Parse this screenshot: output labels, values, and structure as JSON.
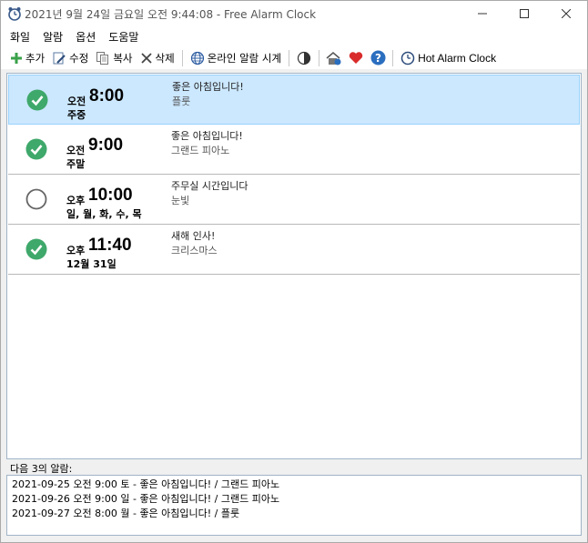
{
  "window": {
    "title": "2021년 9월 24일 금요일 오전 9:44:08 - Free Alarm Clock"
  },
  "menu": [
    "화일",
    "알람",
    "옵션",
    "도움말"
  ],
  "toolbar": {
    "add": "추가",
    "edit": "수정",
    "copy": "복사",
    "delete": "삭제",
    "online": "온라인 알람 시계",
    "hot": "Hot Alarm Clock"
  },
  "alarms": [
    {
      "enabled": true,
      "ampm": "오전",
      "time": "8:00",
      "days": "주중",
      "message": "좋은 아침입니다!",
      "sound": "플룻"
    },
    {
      "enabled": true,
      "ampm": "오전",
      "time": "9:00",
      "days": "주말",
      "message": "좋은 아침입니다!",
      "sound": "그랜드 피아노"
    },
    {
      "enabled": false,
      "ampm": "오후",
      "time": "10:00",
      "days": "일, 월, 화, 수, 목",
      "message": "주무실 시간입니다",
      "sound": "눈빛"
    },
    {
      "enabled": true,
      "ampm": "오후",
      "time": "11:40",
      "days": "12월 31일",
      "message": "새해 인사!",
      "sound": "크리스마스"
    }
  ],
  "next": {
    "label": "다음 3의 알람:",
    "items": [
      "2021-09-25 오전 9:00 토 - 좋은 아침입니다! / 그랜드 피아노",
      "2021-09-26 오전 9:00 일 - 좋은 아침입니다! / 그랜드 피아노",
      "2021-09-27 오전 8:00 월 - 좋은 아침입니다! / 플룻"
    ]
  },
  "colors": {
    "check_green": "#3fa86b",
    "selected_bg": "#cce8ff",
    "heart_red": "#d92b2b",
    "help_blue": "#2a6ebf"
  }
}
